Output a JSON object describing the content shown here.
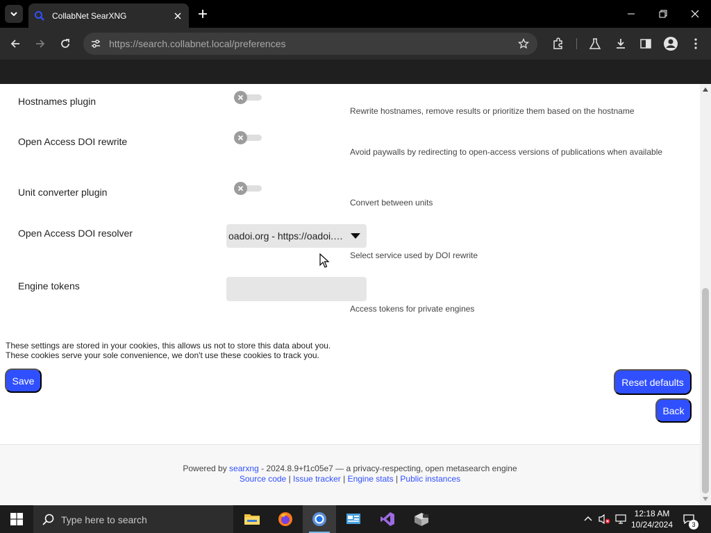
{
  "browser": {
    "tab_title": "CollabNet SearXNG",
    "url_host": "https://search.collabnet.local",
    "url_path": "/preferences"
  },
  "colors": {
    "accent": "#3050ff",
    "chrome_bg": "#2b2b2b",
    "tabstrip_bg": "#000000",
    "page_bg": "#ffffff",
    "taskbar_bg": "#1c1c1c"
  },
  "prefs": {
    "hostnames": {
      "label": "Hostnames plugin",
      "enabled": false,
      "description": "Rewrite hostnames, remove results or prioritize them based on the hostname"
    },
    "oa_doi_rewrite": {
      "label": "Open Access DOI rewrite",
      "enabled": false,
      "description": "Avoid paywalls by redirecting to open-access versions of publications when available"
    },
    "unit_converter": {
      "label": "Unit converter plugin",
      "enabled": false,
      "description": "Convert between units"
    },
    "oa_doi_resolver": {
      "label": "Open Access DOI resolver",
      "value": "oadoi.org - https://oadoi.org/",
      "description": "Select service used by DOI rewrite"
    },
    "engine_tokens": {
      "label": "Engine tokens",
      "value": "",
      "description": "Access tokens for private engines"
    }
  },
  "notice": {
    "line1": "These settings are stored in your cookies, this allows us not to store this data about you.",
    "line2": "These cookies serve your sole convenience, we don't use these cookies to track you."
  },
  "buttons": {
    "save": "Save",
    "reset": "Reset defaults",
    "back": "Back"
  },
  "footer": {
    "powered_prefix": "Powered by ",
    "searxng": "searxng",
    "powered_suffix": " - 2024.8.9+f1c05e7 — a privacy-respecting, open metasearch engine",
    "source_code": "Source code",
    "issue_tracker": "Issue tracker",
    "engine_stats": "Engine stats",
    "public_instances": "Public instances",
    "separator": "|"
  },
  "taskbar": {
    "search_placeholder": "Type here to search",
    "time": "12:18 AM",
    "date": "10/24/2024",
    "notification_count": "3",
    "apps": [
      "file-explorer",
      "firefox",
      "chrome",
      "control-panel",
      "visual-studio",
      "package-app"
    ]
  }
}
